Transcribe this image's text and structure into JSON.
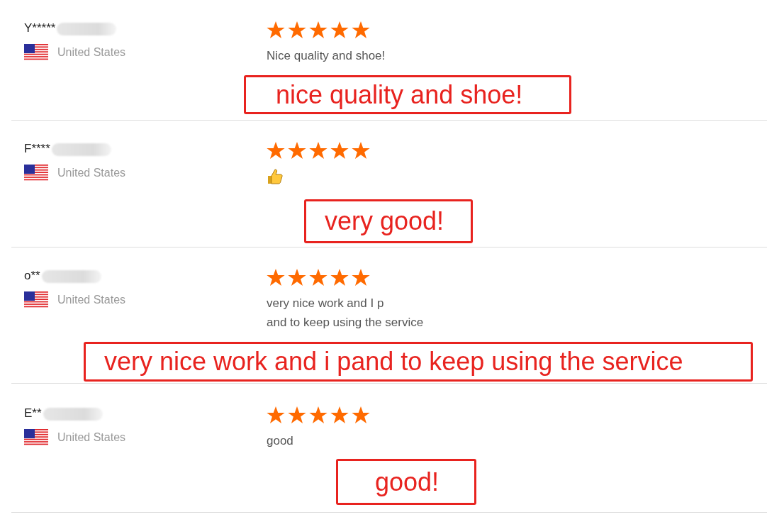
{
  "reviews": [
    {
      "name": "Y*****",
      "country": "United States",
      "stars": 5,
      "body": {
        "kind": "text",
        "lines": [
          "Nice quality and shoe!"
        ]
      },
      "annotation": "nice quality and shoe!"
    },
    {
      "name": "F****",
      "country": "United States",
      "stars": 5,
      "body": {
        "kind": "emoji"
      },
      "annotation": "very good!"
    },
    {
      "name": "o**",
      "country": "United States",
      "stars": 5,
      "body": {
        "kind": "text",
        "lines": [
          "very nice work and I p",
          "and to keep using the service"
        ]
      },
      "annotation": "very nice work and i pand to keep using the service"
    },
    {
      "name": "E**",
      "country": "United States",
      "stars": 5,
      "body": {
        "kind": "text",
        "lines": [
          "good"
        ]
      },
      "annotation": "good!"
    }
  ]
}
